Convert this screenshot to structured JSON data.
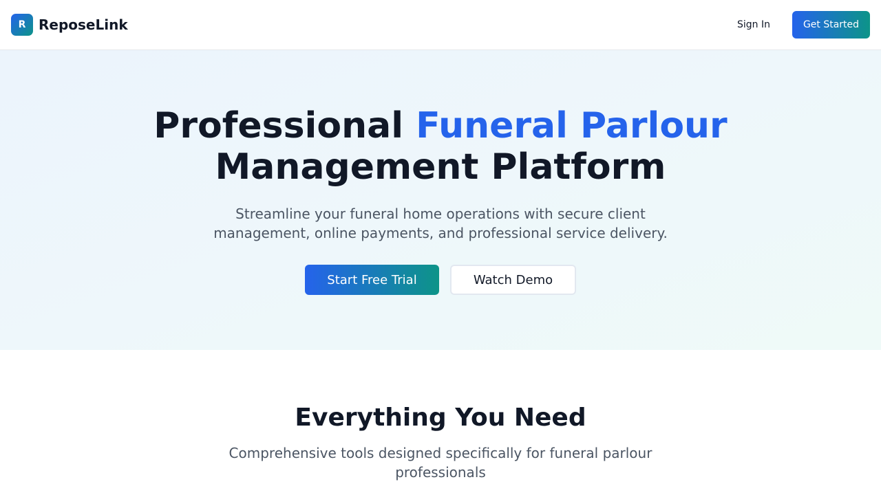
{
  "header": {
    "logo_letter": "R",
    "brand_name": "ReposeLink",
    "signin_label": "Sign In",
    "get_started_label": "Get Started"
  },
  "hero": {
    "title_part1": "Professional ",
    "title_accent": "Funeral Parlour",
    "title_part2": " Management Platform",
    "subtitle": "Streamline your funeral home operations with secure client management, online payments, and professional service delivery.",
    "primary_cta": "Start Free Trial",
    "secondary_cta": "Watch Demo"
  },
  "features": {
    "title": "Everything You Need",
    "subtitle": "Comprehensive tools designed specifically for funeral parlour professionals"
  },
  "colors": {
    "accent_blue": "#2563eb",
    "accent_teal": "#0d9488",
    "text_dark": "#111827",
    "text_muted": "#4b5563"
  }
}
